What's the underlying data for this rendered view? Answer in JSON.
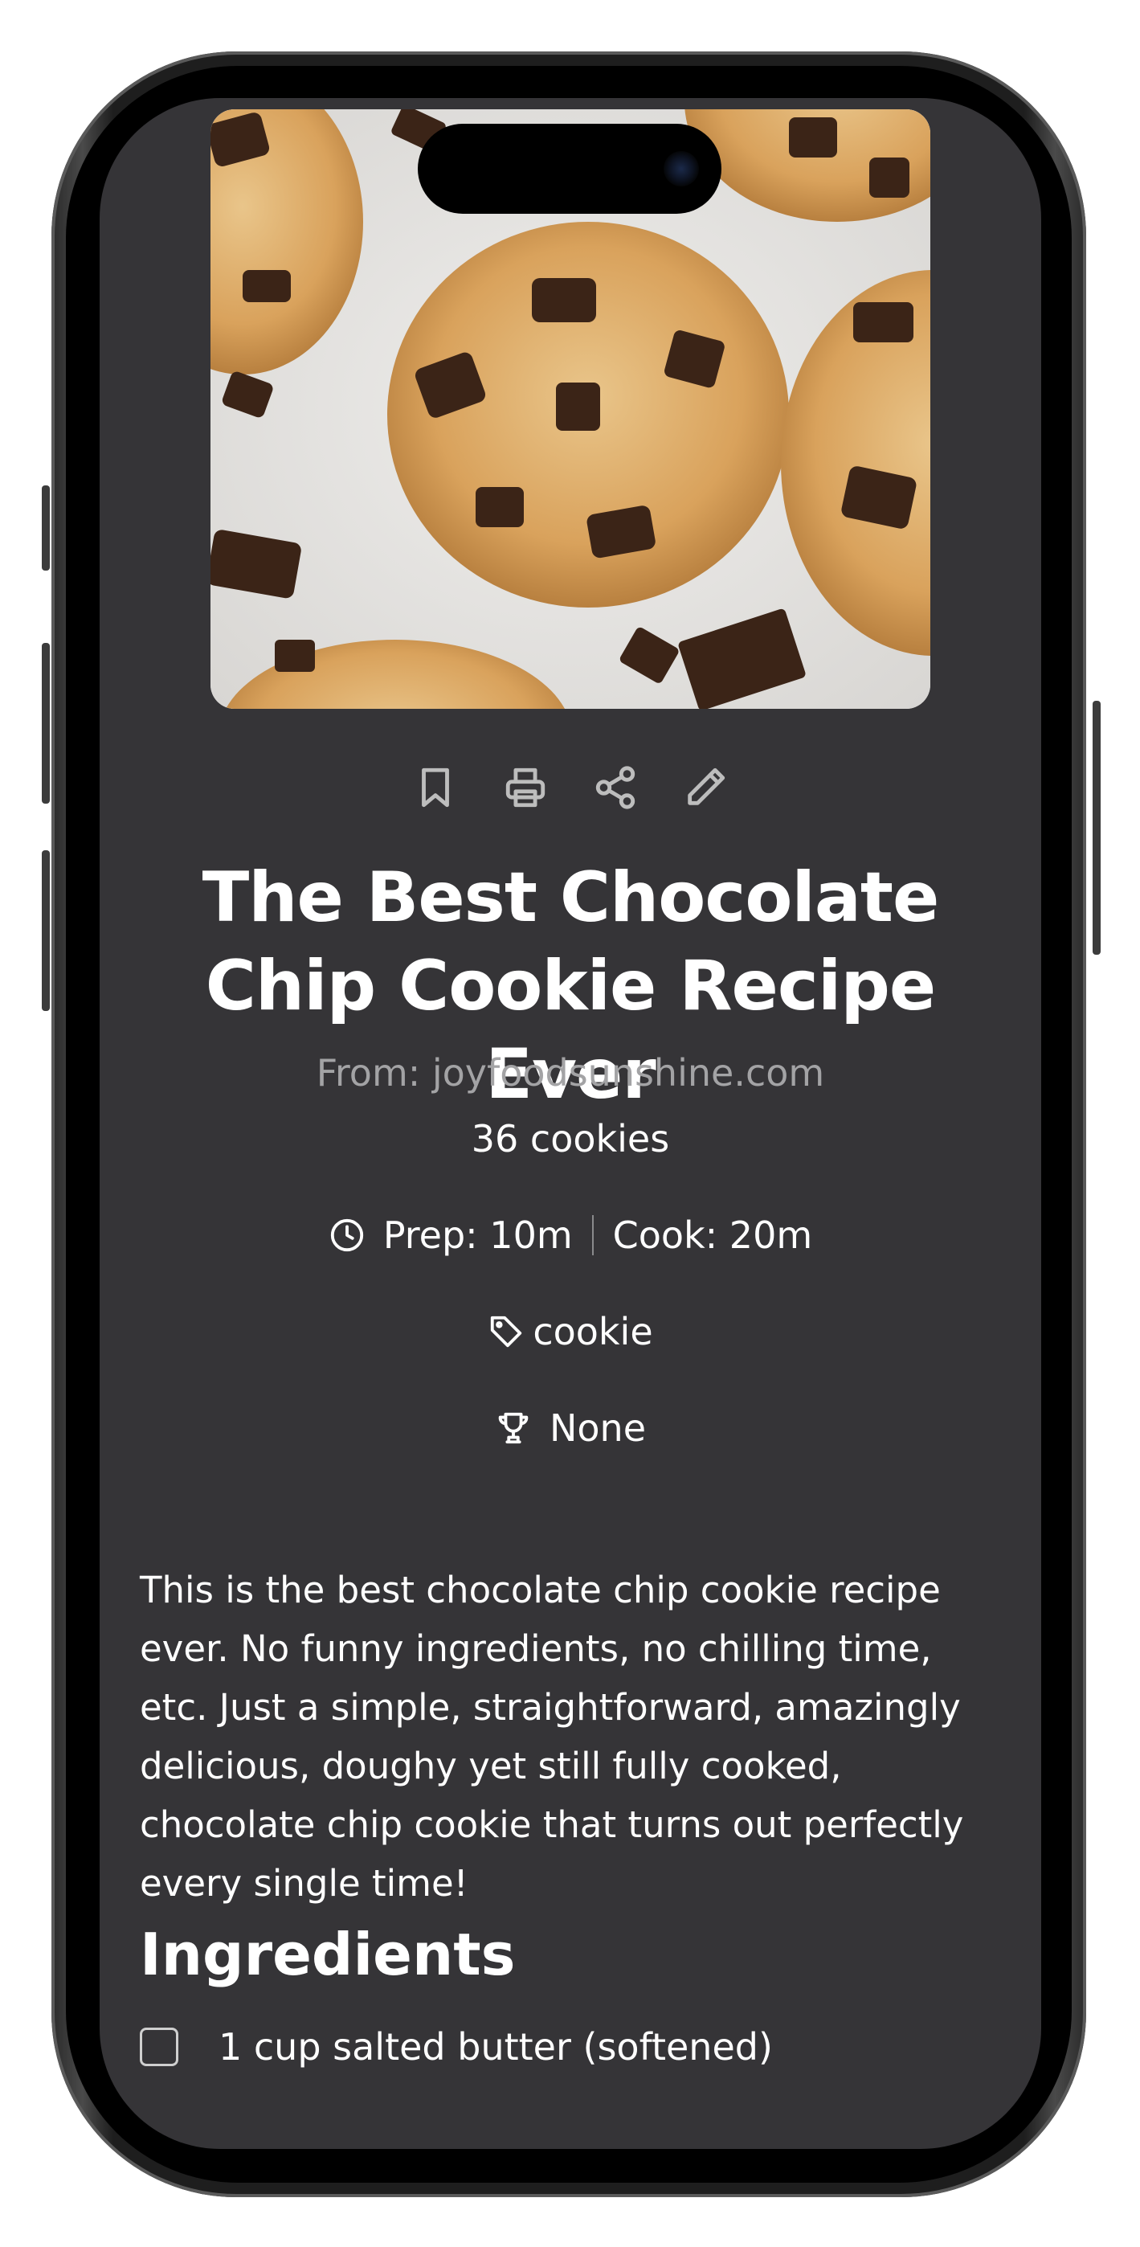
{
  "recipe": {
    "title": "The Best Chocolate Chip Cookie Recipe Ever",
    "source": "From: joyfoodsunshine.com",
    "servings": "36 cookies",
    "prep": "Prep: 10m",
    "cook": "Cook: 20m",
    "tag": "cookie",
    "award": "None",
    "description": "This is the best chocolate chip cookie recipe ever. No funny ingredients, no chilling time, etc. Just a simple, straightforward, amazingly delicious, doughy yet still fully cooked, chocolate chip cookie that turns out perfectly every single time!",
    "ingredients_heading": "Ingredients",
    "ingredients": [
      "1 cup salted butter (softened)"
    ]
  },
  "icons": {
    "bookmark": "bookmark-icon",
    "print": "printer-icon",
    "share": "share-icon",
    "edit": "pencil-icon",
    "clock": "clock-icon",
    "tag": "tag-icon",
    "trophy": "trophy-icon"
  },
  "colors": {
    "background": "#353437",
    "text": "#ffffff",
    "muted": "#a3a3a5",
    "icon": "#bdbdbd"
  }
}
